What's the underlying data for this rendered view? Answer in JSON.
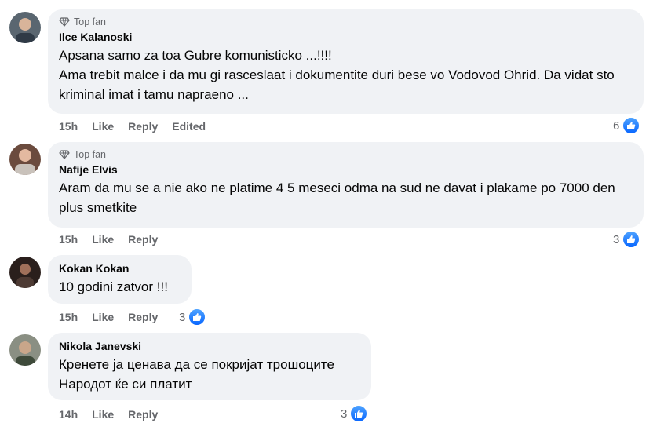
{
  "colors": {
    "bubble_bg": "#f0f2f5",
    "secondary_text": "#65676b",
    "like_blue": "#0866ff"
  },
  "comments": [
    {
      "badge": "Top fan",
      "author": "Ilce Kalanoski",
      "text": "Apsana samo za toa Gubre komunisticko ...!!!!\nAma trebit malce i da mu gi rasceslaat i dokumentite duri bese vo Vodovod Ohrid. Da vidat sto kriminal imat i tamu napraeno ...",
      "time": "15h",
      "like_label": "Like",
      "reply_label": "Reply",
      "edited_label": "Edited",
      "reactions": "6"
    },
    {
      "badge": "Top fan",
      "author": "Nafije Elvis",
      "text": "Aram da mu se a nie ako ne platime 4 5 meseci odma na sud ne davat i plakame po 7000 den plus smetkite",
      "time": "15h",
      "like_label": "Like",
      "reply_label": "Reply",
      "reactions": "3"
    },
    {
      "author": "Kokan Kokan",
      "text": "10 godini zatvor !!!",
      "time": "15h",
      "like_label": "Like",
      "reply_label": "Reply",
      "reactions": "3"
    },
    {
      "author": "Nikola Janevski",
      "text": "Кренете ја ценава да се покријат трошоците\nНародот ќе си платит",
      "time": "14h",
      "like_label": "Like",
      "reply_label": "Reply",
      "reactions": "3"
    }
  ]
}
